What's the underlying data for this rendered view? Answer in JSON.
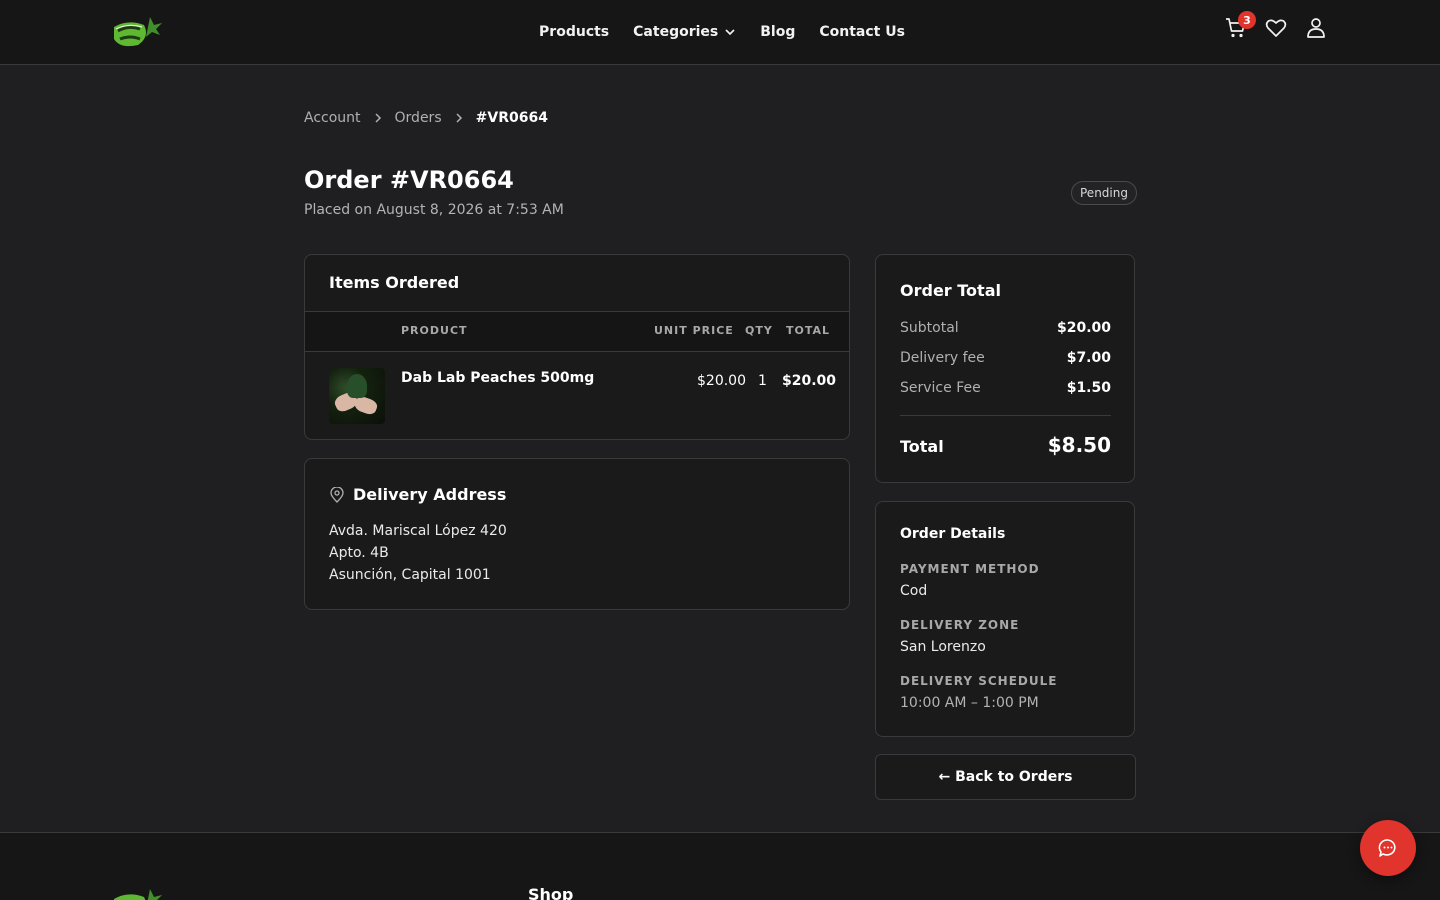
{
  "header": {
    "nav": [
      {
        "label": "Products"
      },
      {
        "label": "Categories"
      },
      {
        "label": "Blog"
      },
      {
        "label": "Contact Us"
      }
    ],
    "cart_count": "3"
  },
  "breadcrumb": {
    "items": [
      "Account",
      "Orders",
      "#VR0664"
    ]
  },
  "order": {
    "title": "Order #VR0664",
    "placed": "Placed on August 8, 2026 at 7:53 AM",
    "status": "Pending"
  },
  "items_card": {
    "title": "Items Ordered",
    "columns": {
      "product": "PRODUCT",
      "unit_price": "UNIT PRICE",
      "qty": "QTY",
      "total": "TOTAL"
    },
    "rows": [
      {
        "name": "Dab Lab Peaches 500mg",
        "unit_price": "$20.00",
        "qty": "1",
        "total": "$20.00"
      }
    ]
  },
  "delivery": {
    "title": "Delivery Address",
    "lines": [
      "Avda. Mariscal López 420",
      "Apto. 4B",
      "Asunción, Capital 1001"
    ]
  },
  "totals": {
    "title": "Order Total",
    "lines": [
      {
        "label": "Subtotal",
        "value": "$20.00"
      },
      {
        "label": "Delivery fee",
        "value": "$7.00"
      },
      {
        "label": "Service Fee",
        "value": "$1.50"
      }
    ],
    "grand_label": "Total",
    "grand_value": "$8.50"
  },
  "details": {
    "title": "Order Details",
    "fields": [
      {
        "label": "PAYMENT METHOD",
        "value": "Cod"
      },
      {
        "label": "DELIVERY ZONE",
        "value": "San Lorenzo"
      },
      {
        "label": "DELIVERY SCHEDULE",
        "value": "10:00 AM – 1:00 PM"
      }
    ]
  },
  "back_label": "← Back to Orders",
  "footer": {
    "shop_heading": "Shop"
  },
  "colors": {
    "accent": "#e0342c",
    "background": "#1f1f21",
    "logo_green": "#5fb832"
  }
}
